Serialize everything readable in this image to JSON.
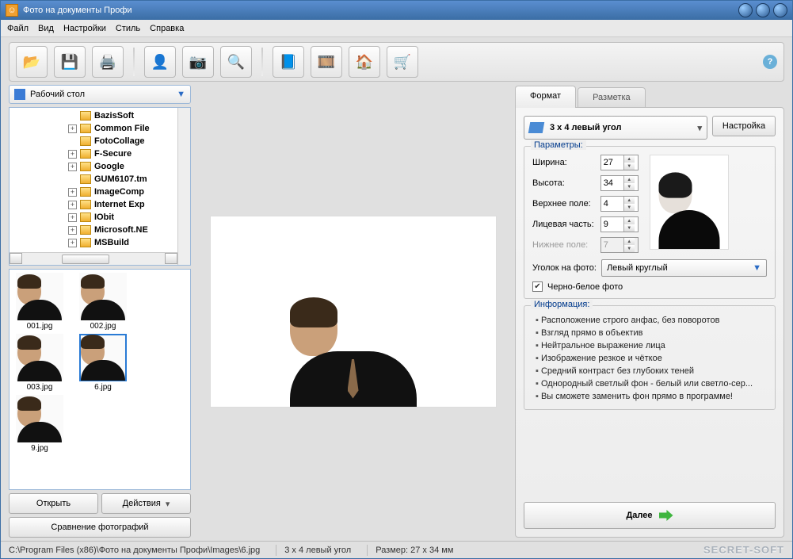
{
  "title": "Фото на документы Профи",
  "menu": [
    "Файл",
    "Вид",
    "Настройки",
    "Стиль",
    "Справка"
  ],
  "folder_picker": "Рабочий стол",
  "tree": [
    {
      "label": "BazisSoft",
      "expand": ""
    },
    {
      "label": "Common File",
      "expand": "+"
    },
    {
      "label": "FotoCollage",
      "expand": ""
    },
    {
      "label": "F-Secure",
      "expand": "+"
    },
    {
      "label": "Google",
      "expand": "+"
    },
    {
      "label": "GUM6107.tm",
      "expand": ""
    },
    {
      "label": "ImageComp",
      "expand": "+"
    },
    {
      "label": "Internet Exp",
      "expand": "+"
    },
    {
      "label": "IObit",
      "expand": "+"
    },
    {
      "label": "Microsoft.NE",
      "expand": "+"
    },
    {
      "label": "MSBuild",
      "expand": "+"
    }
  ],
  "thumbs": [
    {
      "label": "001.jpg",
      "sel": false
    },
    {
      "label": "002.jpg",
      "sel": false
    },
    {
      "label": "003.jpg",
      "sel": false
    },
    {
      "label": "6.jpg",
      "sel": true
    },
    {
      "label": "9.jpg",
      "sel": false
    }
  ],
  "left_buttons": {
    "open": "Открыть",
    "actions": "Действия",
    "compare": "Сравнение фотографий"
  },
  "tabs": {
    "format": "Формат",
    "markup": "Разметка"
  },
  "format": {
    "preset": "3 x 4 левый угол",
    "config_btn": "Настройка",
    "group_params": "Параметры:",
    "labels": {
      "width": "Ширина:",
      "height": "Высота:",
      "top": "Верхнее поле:",
      "face": "Лицевая часть:",
      "bottom": "Нижнее поле:"
    },
    "values": {
      "width": "27",
      "height": "34",
      "top": "4",
      "face": "9",
      "bottom": "7"
    },
    "corner_label": "Уголок на фото:",
    "corner_value": "Левый круглый",
    "bw_label": "Черно-белое фото",
    "group_info": "Информация:",
    "info": [
      "Расположение строго анфас, без поворотов",
      "Взгляд прямо в объектив",
      "Нейтральное выражение лица",
      "Изображение резкое и чёткое",
      "Средний контраст без глубоких теней",
      "Однородный светлый фон - белый или светло-сер...",
      "Вы сможете заменить фон прямо в программе!"
    ],
    "next": "Далее"
  },
  "status": {
    "path": "C:\\Program Files (x86)\\Фото на документы Профи\\Images\\6.jpg",
    "preset": "3 x 4 левый угол",
    "size": "Размер: 27 x 34 мм",
    "brand": "SECRET-SOFT"
  }
}
